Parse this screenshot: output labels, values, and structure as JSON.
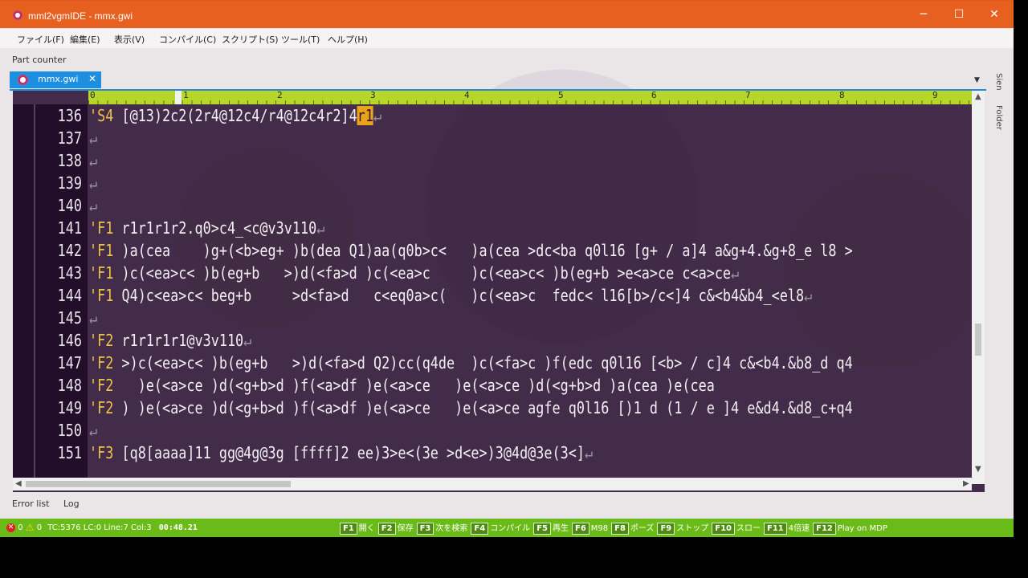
{
  "window": {
    "title": "mml2vgmIDE - mmx.gwi",
    "controls": {
      "minimize": "─",
      "maximize": "☐",
      "close": "✕"
    }
  },
  "menu": [
    "ファイル(F)",
    "編集(E)",
    "表示(V)",
    "コンパイル(C)",
    "スクリプト(S)",
    "ツール(T)",
    "ヘルプ(H)"
  ],
  "panels": {
    "part_counter": "Part counter",
    "side_tabs": [
      "Sien",
      "Folder"
    ]
  },
  "tab": {
    "label": "mmx.gwi",
    "close": "✕"
  },
  "ruler": {
    "numbers": [
      "0",
      "1",
      "2",
      "3",
      "4",
      "5",
      "6",
      "7",
      "8",
      "9"
    ]
  },
  "editor": {
    "eol": "↵",
    "lines": [
      {
        "num": "136",
        "tag": "'S4",
        "text": " [@13)2c2(2r4@12c4/r4@12c4r2]4",
        "caret": "r1",
        "eol": true
      },
      {
        "num": "137",
        "tag": "",
        "text": "",
        "eol": true
      },
      {
        "num": "138",
        "tag": "",
        "text": "",
        "eol": true
      },
      {
        "num": "139",
        "tag": "",
        "text": "",
        "eol": true
      },
      {
        "num": "140",
        "tag": "",
        "text": "",
        "eol": true
      },
      {
        "num": "141",
        "tag": "'F1",
        "text": " r1r1r1r2.q0>c4_<c@v3v110",
        "eol": true
      },
      {
        "num": "142",
        "tag": "'F1",
        "text": " )a(cea    )g+(<b>eg+ )b(dea Q1)aa(q0b>c<   )a(cea >dc<ba q0l16 [g+ / a]4 a&g+4.&g+8_e l8 >",
        "eol": false
      },
      {
        "num": "143",
        "tag": "'F1",
        "text": " )c(<ea>c< )b(eg+b   >)d(<fa>d )c(<ea>c     )c(<ea>c< )b(eg+b >e<a>ce c<a>ce",
        "eol": true
      },
      {
        "num": "144",
        "tag": "'F1",
        "text": " Q4)c<ea>c< beg+b     >d<fa>d   c<eq0a>c(   )c(<ea>c  fedc< l16[b>/c<]4 c&<b4&b4_<el8",
        "eol": true
      },
      {
        "num": "145",
        "tag": "",
        "text": "",
        "eol": true
      },
      {
        "num": "146",
        "tag": "'F2",
        "text": " r1r1r1r1@v3v110",
        "eol": true
      },
      {
        "num": "147",
        "tag": "'F2",
        "text": " >)c(<ea>c< )b(eg+b   >)d(<fa>d Q2)cc(q4de  )c(<fa>c )f(edc q0l16 [<b> / c]4 c&<b4.&b8_d q4",
        "eol": false
      },
      {
        "num": "148",
        "tag": "'F2",
        "text": "   )e(<a>ce )d(<g+b>d )f(<a>df )e(<a>ce   )e(<a>ce )d(<g+b>d )a(cea )e(cea",
        "eol": false
      },
      {
        "num": "149",
        "tag": "'F2",
        "text": " ) )e(<a>ce )d(<g+b>d )f(<a>df )e(<a>ce   )e(<a>ce agfe q0l16 [)1 d (1 / e ]4 e&d4.&d8_c+q4",
        "eol": false
      },
      {
        "num": "150",
        "tag": "",
        "text": "",
        "eol": true
      },
      {
        "num": "151",
        "tag": "'F3",
        "text": " [q8[aaaa]11 gg@4g@3g [ffff]2 ee)3>e<(3e >d<e>)3@4d@3e(3<]",
        "eol": true
      }
    ]
  },
  "bottom_tabs": [
    "Error list",
    "Log"
  ],
  "status": {
    "errors": "0",
    "warnings": "0",
    "info": "TC:5376 LC:0 Line:7 Col:3",
    "time": "00:48.21",
    "fkeys": [
      {
        "key": "F1",
        "label": "開く"
      },
      {
        "key": "F2",
        "label": "保存"
      },
      {
        "key": "F3",
        "label": "次を検索"
      },
      {
        "key": "F4",
        "label": "コンパイル"
      },
      {
        "key": "F5",
        "label": "再生"
      },
      {
        "key": "F6",
        "label": "M98"
      },
      {
        "key": "F8",
        "label": "ポーズ"
      },
      {
        "key": "F9",
        "label": "ストップ"
      },
      {
        "key": "F10",
        "label": "スロー"
      },
      {
        "key": "F11",
        "label": "4倍速"
      },
      {
        "key": "F12",
        "label": "Play on MDP"
      }
    ]
  },
  "colors": {
    "titlebar": "#e8601f",
    "tab": "#1e8fe0",
    "ruler": "#b8d62a",
    "statusbar": "#6bbb18",
    "tag": "#f0c24a",
    "caret": "#e8a31a"
  }
}
